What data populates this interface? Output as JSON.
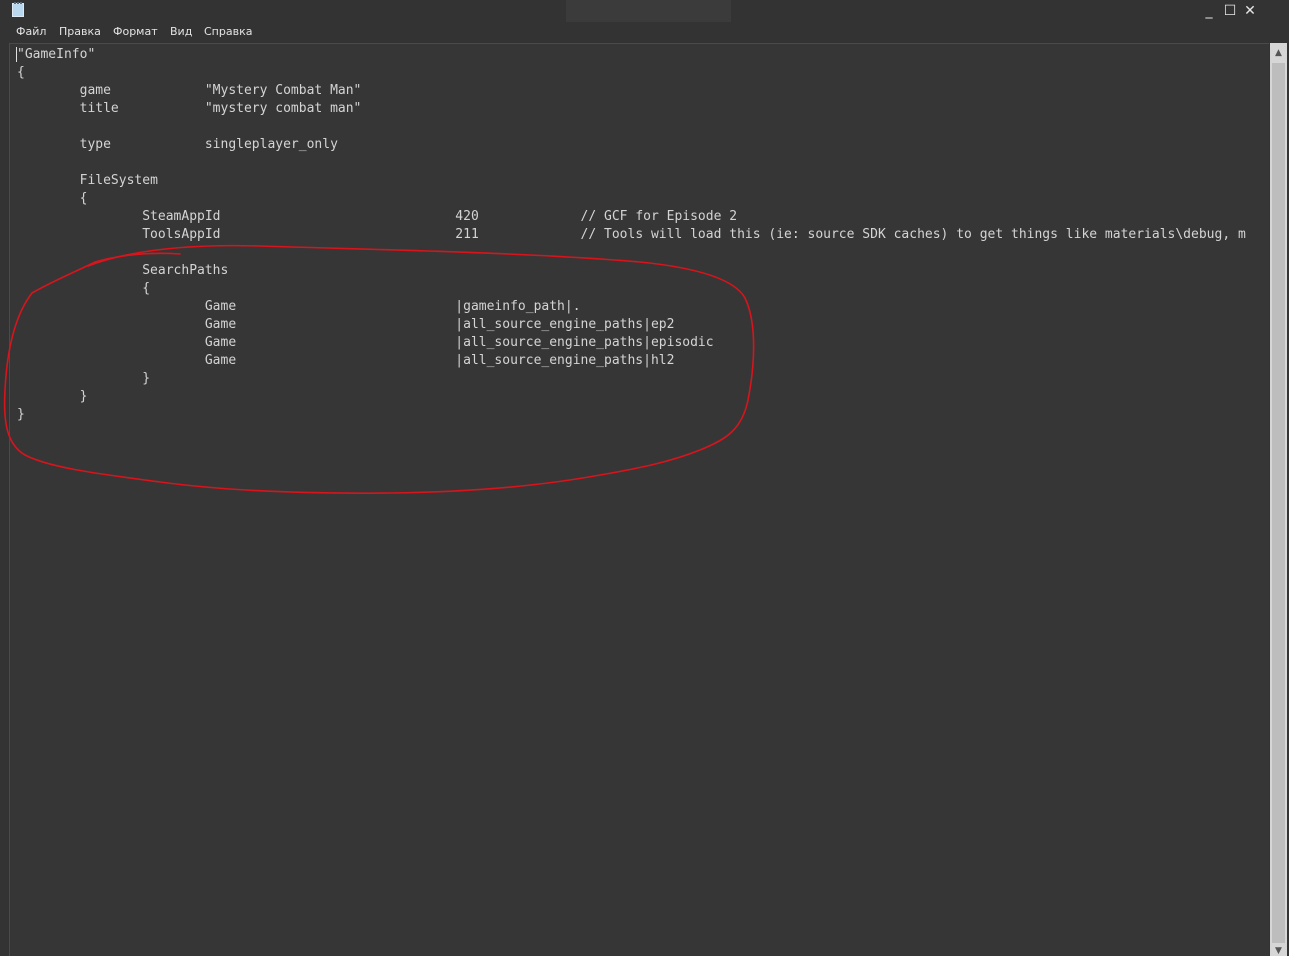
{
  "window": {
    "icon": "notepad-icon",
    "controls": {
      "minimize": "_",
      "maximize": "☐",
      "close": "✕"
    }
  },
  "menu": {
    "file": "Файл",
    "edit": "Правка",
    "format": "Формат",
    "view": "Вид",
    "help": "Справка"
  },
  "editor": {
    "content": "\"GameInfo\"\n{\n\tgame\t\t\"Mystery Combat Man\"\n\ttitle\t\t\"mystery combat man\"\n\n\ttype\t\tsingleplayer_only\n\n\tFileSystem\n\t{\n\t\tSteamAppId\t\t\t\t420\t\t// GCF for Episode 2\n\t\tToolsAppId\t\t\t\t211\t\t// Tools will load this (ie: source SDK caches) to get things like materials\\debug, m\n\n\t\tSearchPaths\n\t\t{\n\t\t\tGame\t\t\t\t|gameinfo_path|.\n\t\t\tGame\t\t\t\t|all_source_engine_paths|ep2\n\t\t\tGame\t\t\t\t|all_source_engine_paths|episodic\n\t\t\tGame\t\t\t\t|all_source_engine_paths|hl2\n\t\t}\n\t}\n}"
  },
  "annotation": {
    "color": "#d8141c"
  }
}
